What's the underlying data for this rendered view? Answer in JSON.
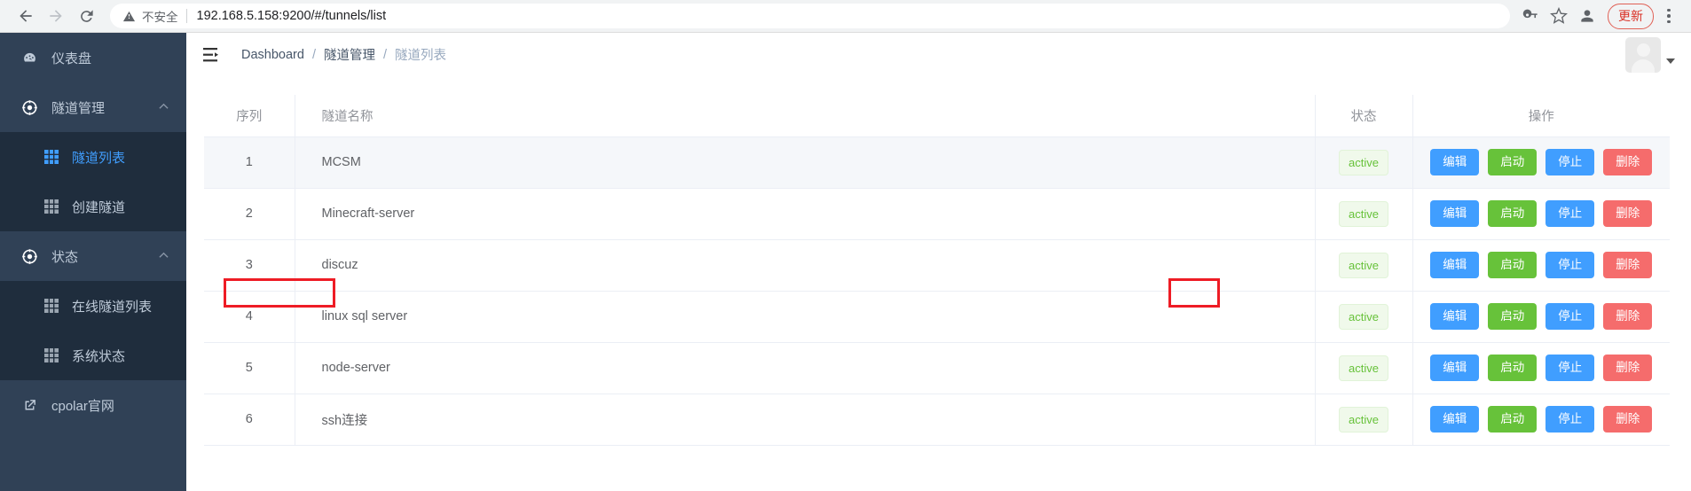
{
  "browser": {
    "back_icon": "back-arrow-icon",
    "forward_icon": "forward-arrow-icon",
    "reload_icon": "reload-icon",
    "security_icon": "warning-triangle-icon",
    "security_label": "不安全",
    "url": "192.168.5.158:9200/#/tunnels/list",
    "password_icon": "key-icon",
    "bookmark_icon": "star-icon",
    "profile_icon": "person-icon",
    "update_label": "更新",
    "menu_icon": "kebab-menu-icon"
  },
  "sidebar": {
    "items": [
      {
        "label": "仪表盘",
        "icon": "dashboard-icon",
        "name": "dashboard"
      },
      {
        "label": "隧道管理",
        "icon": "tunnel-icon",
        "name": "tunnel-management",
        "arrow": "⌃"
      },
      {
        "label": "隧道列表",
        "icon": "grid-icon",
        "name": "tunnel-list",
        "active": true
      },
      {
        "label": "创建隧道",
        "icon": "grid-icon",
        "name": "create-tunnel"
      },
      {
        "label": "状态",
        "icon": "status-icon",
        "name": "status",
        "arrow": "⌃"
      },
      {
        "label": "在线隧道列表",
        "icon": "grid-icon",
        "name": "online-tunnel-list"
      },
      {
        "label": "系统状态",
        "icon": "grid-icon",
        "name": "system-status"
      },
      {
        "label": "cpolar官网",
        "icon": "external-link-icon",
        "name": "cpolar-website"
      }
    ]
  },
  "navbar": {
    "hamburger_icon": "collapse-menu-icon",
    "breadcrumb": [
      {
        "label": "Dashboard",
        "muted": false
      },
      {
        "label": "隧道管理",
        "muted": false
      },
      {
        "label": "隧道列表",
        "muted": true
      }
    ],
    "separator": "/",
    "avatar_icon": "user-avatar-icon",
    "caret_icon": "chevron-down-icon"
  },
  "table": {
    "headers": {
      "index": "序列",
      "name": "隧道名称",
      "state": "状态",
      "ops": "操作"
    },
    "buttons": {
      "edit": "编辑",
      "start": "启动",
      "stop": "停止",
      "delete": "删除"
    },
    "rows": [
      {
        "index": "1",
        "name": "MCSM",
        "state": "active"
      },
      {
        "index": "2",
        "name": "Minecraft-server",
        "state": "active"
      },
      {
        "index": "3",
        "name": "discuz",
        "state": "active"
      },
      {
        "index": "4",
        "name": "linux sql server",
        "state": "active"
      },
      {
        "index": "5",
        "name": "node-server",
        "state": "active"
      },
      {
        "index": "6",
        "name": "ssh连接",
        "state": "active"
      }
    ]
  },
  "colors": {
    "sidebar_bg": "#304156",
    "submenu_bg": "#1f2d3d",
    "accent_blue": "#409eff",
    "success_green": "#67c23a",
    "danger_red": "#f56c6c",
    "highlight_red": "#ee1c25"
  }
}
